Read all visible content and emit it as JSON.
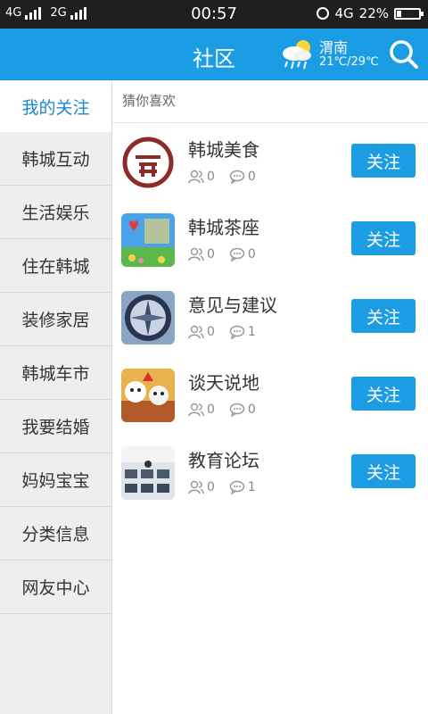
{
  "statusbar": {
    "net1": "4G",
    "net2": "2G",
    "time": "00:57",
    "net3": "4G",
    "battery": "22%",
    "battery_level": 0.22
  },
  "header": {
    "title": "社区",
    "weather_city": "渭南",
    "weather_temp": "21℃/29℃",
    "weather_icon": "cloud-rain-sun-icon",
    "search_icon": "search-icon"
  },
  "sidebar": {
    "items": [
      {
        "label": "我的关注"
      },
      {
        "label": "韩城互动"
      },
      {
        "label": "生活娱乐"
      },
      {
        "label": "住在韩城"
      },
      {
        "label": "装修家居"
      },
      {
        "label": "韩城车市"
      },
      {
        "label": "我要结婚"
      },
      {
        "label": "妈妈宝宝"
      },
      {
        "label": "分类信息"
      },
      {
        "label": "网友中心"
      }
    ]
  },
  "main": {
    "section_title": "猜你喜欢",
    "rows": [
      {
        "name": "韩城美食",
        "members": "0",
        "posts": "0",
        "follow": "关注"
      },
      {
        "name": "韩城茶座",
        "members": "0",
        "posts": "0",
        "follow": "关注"
      },
      {
        "name": "意见与建议",
        "members": "0",
        "posts": "1",
        "follow": "关注"
      },
      {
        "name": "谈天说地",
        "members": "0",
        "posts": "0",
        "follow": "关注"
      },
      {
        "name": "教育论坛",
        "members": "0",
        "posts": "1",
        "follow": "关注"
      }
    ]
  },
  "colors": {
    "accent": "#1b9de5",
    "active_text": "#1b86d4",
    "sidebar_bg": "#eeeeee"
  }
}
